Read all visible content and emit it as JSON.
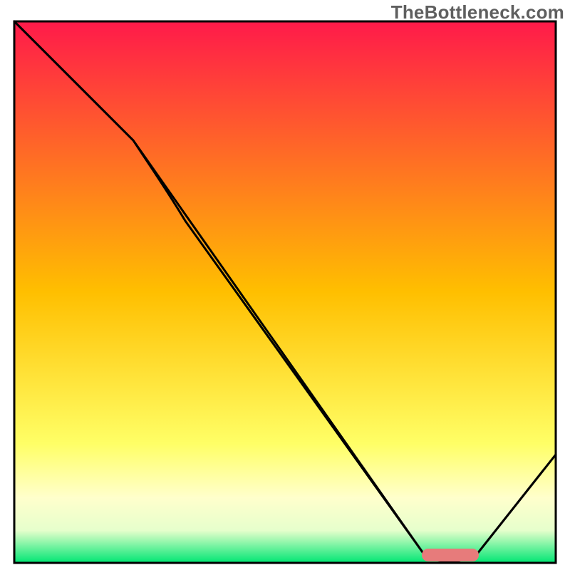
{
  "watermark": "TheBottleneck.com",
  "chart_data": {
    "type": "line",
    "title": "",
    "xlabel": "",
    "ylabel": "",
    "xlim": [
      0,
      100
    ],
    "ylim": [
      0,
      100
    ],
    "x": [
      0,
      22,
      76,
      85,
      100
    ],
    "values": [
      100,
      78,
      1,
      1,
      20
    ],
    "marker": {
      "x_start": 76,
      "x_end": 85,
      "y": 1,
      "color": "#e77b7b"
    },
    "background_gradient": {
      "stops": [
        {
          "offset": 0,
          "color": "#ff1a4a"
        },
        {
          "offset": 50,
          "color": "#ffbf00"
        },
        {
          "offset": 78,
          "color": "#ffff66"
        },
        {
          "offset": 88,
          "color": "#ffffcc"
        },
        {
          "offset": 94,
          "color": "#e6ffcc"
        },
        {
          "offset": 100,
          "color": "#00e673"
        }
      ]
    },
    "border_color": "#000000",
    "line_color": "#000000"
  }
}
